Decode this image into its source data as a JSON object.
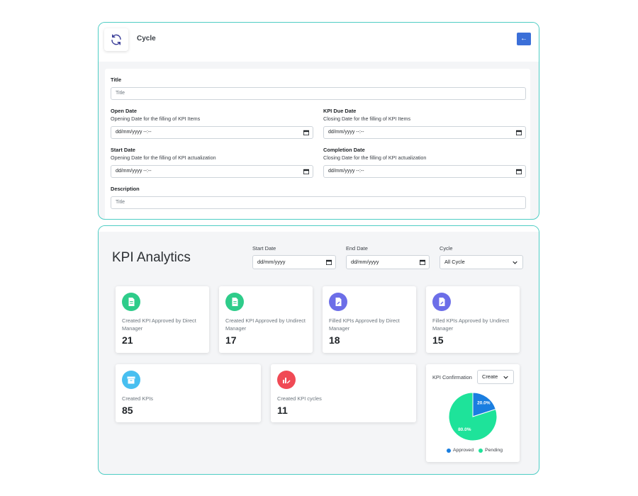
{
  "cycle_form": {
    "header_title": "Cycle",
    "back_button_label": "←",
    "title_label": "Title",
    "title_placeholder": "Title",
    "open_date_label": "Open Date",
    "open_date_hint": "Opening Date for the filling of KPI Items",
    "open_date_value": "dd/mm/yyyy --:--",
    "due_date_label": "KPI Due Date",
    "due_date_hint": "Closing Date for the filling of KPI Items",
    "due_date_value": "dd/mm/yyyy --:--",
    "start_date_label": "Start Date",
    "start_date_hint": "Opening Date for the filling of KPI actualization",
    "start_date_value": "dd/mm/yyyy --:--",
    "completion_date_label": "Completion Date",
    "completion_date_hint": "Closing Date for the filling of KPI actualization",
    "completion_date_value": "dd/mm/yyyy --:--",
    "description_label": "Description",
    "description_placeholder": "Title"
  },
  "analytics": {
    "title": "KPI Analytics",
    "filters": {
      "start_date_label": "Start Date",
      "start_date_value": "dd/mm/yyyy",
      "end_date_label": "End Date",
      "end_date_value": "dd/mm/yyyy",
      "cycle_label": "Cycle",
      "cycle_value": "All Cycle"
    },
    "stats": [
      {
        "label": "Created KPI Approved by Direct Manager",
        "value": "21",
        "color": "#2ecc8a",
        "icon": "document-icon"
      },
      {
        "label": "Created KPI Approved by Undirect Manager",
        "value": "17",
        "color": "#2ecc8a",
        "icon": "document-icon"
      },
      {
        "label": "Filled KPIs Approved by Direct Manager",
        "value": "18",
        "color": "#6c6ee8",
        "icon": "document-edit-icon"
      },
      {
        "label": "Filled KPIs Approved by Undirect Manager",
        "value": "15",
        "color": "#6c6ee8",
        "icon": "document-edit-icon"
      },
      {
        "label": "Created KPIs",
        "value": "85",
        "color": "#48bff0",
        "icon": "archive-icon"
      },
      {
        "label": "Created KPI cycles",
        "value": "11",
        "color": "#f04a55",
        "icon": "chart-edit-icon"
      }
    ],
    "confirmation": {
      "label": "KPI Confirmation",
      "select_value": "Create",
      "approved_label": "Approved",
      "pending_label": "Pending",
      "approved_pct_label": "20.0%",
      "pending_pct_label": "80.0%",
      "approved_color": "#1a7ee0",
      "pending_color": "#1ee39a"
    }
  },
  "chart_data": {
    "type": "pie",
    "categories": [
      "Approved",
      "Pending"
    ],
    "values": [
      20.0,
      80.0
    ],
    "legend": "bottom",
    "colors": [
      "#1a7ee0",
      "#1ee39a"
    ]
  }
}
